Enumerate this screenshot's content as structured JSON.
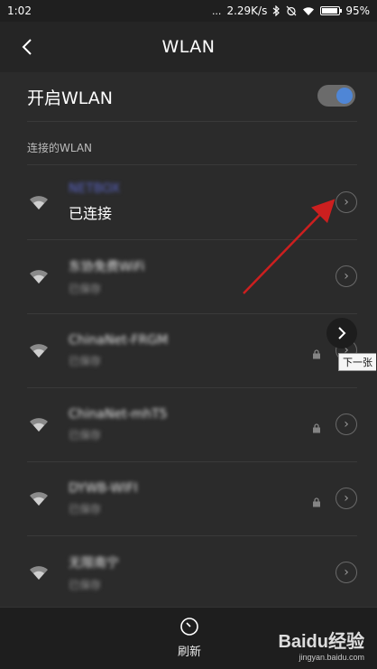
{
  "status_bar": {
    "time": "1:02",
    "ellipsis": "...",
    "network_speed": "2.29K/s",
    "battery_percent": "95%",
    "battery_level": 0.95
  },
  "titlebar": {
    "title": "WLAN"
  },
  "enable": {
    "label": "开启WLAN",
    "enabled": true
  },
  "section": {
    "title": "连接的WLAN"
  },
  "networks": [
    {
      "name": "NETBOX",
      "status": "已连接",
      "locked": false,
      "connected": true
    },
    {
      "name": "东协免费WiFi",
      "status": "已保存",
      "locked": false,
      "connected": false
    },
    {
      "name": "ChinaNet-FRGM",
      "status": "已保存",
      "locked": true,
      "connected": false
    },
    {
      "name": "ChinaNet-mhT5",
      "status": "已保存",
      "locked": true,
      "connected": false
    },
    {
      "name": "DYWB-WIFI",
      "status": "已保存",
      "locked": true,
      "connected": false
    },
    {
      "name": "无限南宁",
      "status": "已保存",
      "locked": false,
      "connected": false
    }
  ],
  "overlay": {
    "tooltip": "下一张"
  },
  "bottom": {
    "refresh_label": "刷新"
  },
  "watermark": {
    "brand": "Baidu经验",
    "url": "jingyan.baidu.com"
  },
  "colors": {
    "accent": "#4f86d6",
    "arrow": "#cc1f1f"
  }
}
